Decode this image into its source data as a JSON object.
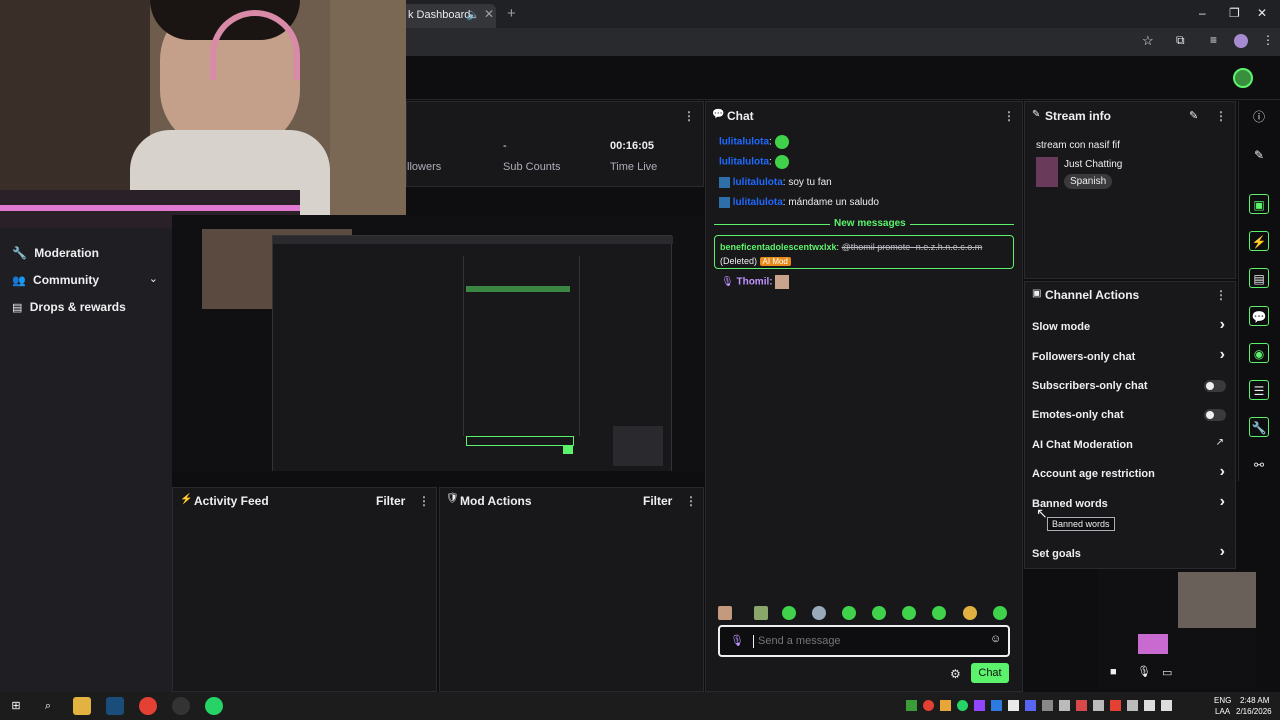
{
  "browser": {
    "tab_title": "k Dashboard",
    "new_tab": "+",
    "win_min": "–",
    "win_max": "❐",
    "win_close": "✕"
  },
  "sidebar": {
    "items": [
      {
        "label": "Moderation"
      },
      {
        "label": "Community"
      },
      {
        "label": "Drops & rewards"
      }
    ]
  },
  "stats": {
    "followers_label": "llowers",
    "sub_value": "-",
    "sub_label": "Sub Counts",
    "time_value": "00:16:05",
    "time_label": "Time Live"
  },
  "activity": {
    "title": "Activity Feed",
    "filter": "Filter"
  },
  "mod_actions": {
    "title": "Mod Actions",
    "filter": "Filter"
  },
  "chat": {
    "title": "Chat",
    "messages": [
      {
        "user": "lulitalulota",
        "text": ""
      },
      {
        "user": "lulitalulota",
        "text": ""
      },
      {
        "user": "lulitalulota",
        "text": "soy tu fan"
      },
      {
        "user": "lulitalulota",
        "text": "mándame un saludo"
      }
    ],
    "new_messages": "New messages",
    "flagged_user": "beneficentadolescentwxlxk",
    "flagged_text": "@thomil promote- n.e.z.h.n.e.c.o.m",
    "deleted": "(Deleted)",
    "ai_badge": "AI Mod",
    "thomil": "Thomil:",
    "placeholder": "Send a message",
    "send": "Chat"
  },
  "stream_info": {
    "title": "Stream info",
    "stream_title": "stream con nasif fif",
    "category": "Just Chatting",
    "language": "Spanish"
  },
  "channel_actions": {
    "title": "Channel Actions",
    "rows": [
      {
        "label": "Slow mode"
      },
      {
        "label": "Followers-only chat"
      },
      {
        "label": "Subscribers-only chat"
      },
      {
        "label": "Emotes-only chat"
      },
      {
        "label": "AI Chat Moderation"
      },
      {
        "label": "Account age restriction"
      },
      {
        "label": "Banned words"
      },
      {
        "label": "Set goals"
      }
    ],
    "tooltip": "Banned words"
  },
  "taskbar": {
    "lang": "ENG",
    "region": "LAA",
    "time": "2:48 AM",
    "date": "2/16/2026"
  },
  "colors": {
    "accent": "#5bf36b",
    "twitch_purple": "#9146ff",
    "link_blue": "#1f69ff"
  }
}
